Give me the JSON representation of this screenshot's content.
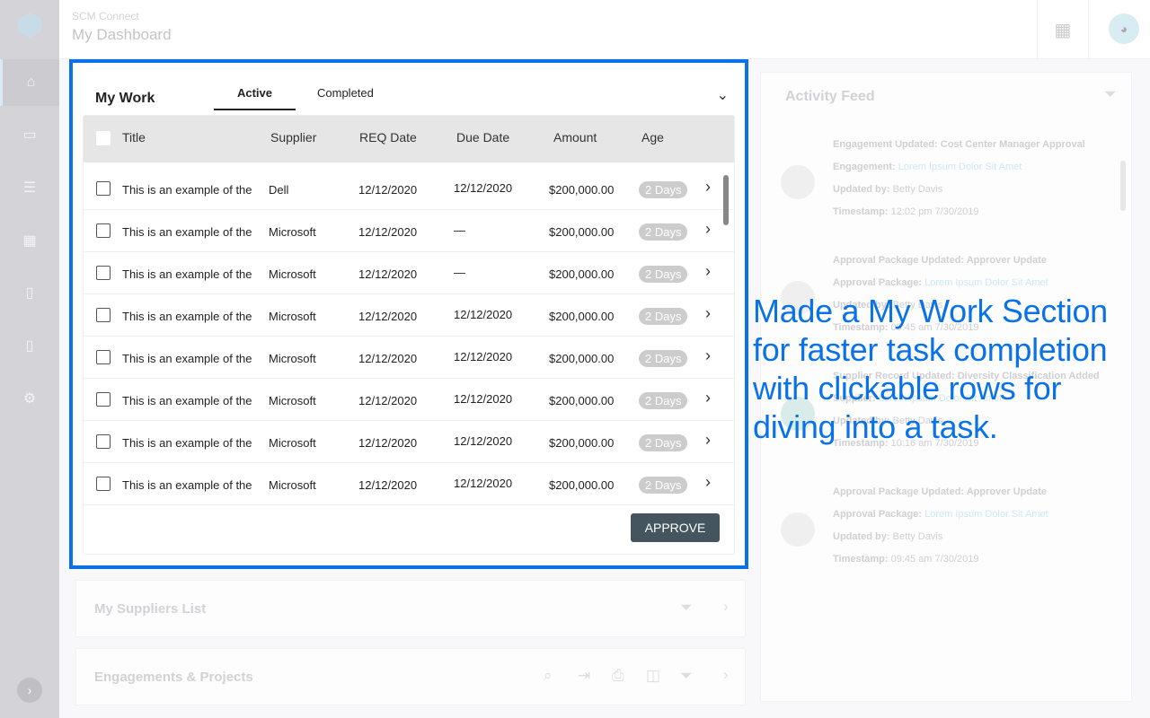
{
  "app": {
    "name": "SCM Connect",
    "page_title": "My Dashboard"
  },
  "sidebar": {
    "items": [
      "home-icon",
      "dashboard-icon",
      "tasks-icon",
      "table-icon",
      "contacts-icon",
      "reports-icon",
      "settings-icon"
    ]
  },
  "my_work": {
    "title": "My Work",
    "tabs": [
      "Active",
      "Completed"
    ],
    "columns": [
      "Title",
      "Supplier",
      "REQ Date",
      "Due Date",
      "Amount",
      "Age"
    ],
    "rows": [
      {
        "title": "This is an example of the",
        "supplier": "Dell",
        "req": "12/12/2020",
        "due": "12/12/2020",
        "amount": "$200,000.00",
        "age": "2 Days"
      },
      {
        "title": "This is an example of the",
        "supplier": "Microsoft",
        "req": "12/12/2020",
        "due": "—",
        "amount": "$200,000.00",
        "age": "2 Days"
      },
      {
        "title": "This is an example of the",
        "supplier": "Microsoft",
        "req": "12/12/2020",
        "due": "—",
        "amount": "$200,000.00",
        "age": "2 Days"
      },
      {
        "title": "This is an example of the",
        "supplier": "Microsoft",
        "req": "12/12/2020",
        "due": "12/12/2020",
        "amount": "$200,000.00",
        "age": "2 Days"
      },
      {
        "title": "This is an example of the",
        "supplier": "Microsoft",
        "req": "12/12/2020",
        "due": "12/12/2020",
        "amount": "$200,000.00",
        "age": "2 Days"
      },
      {
        "title": "This is an example of the",
        "supplier": "Microsoft",
        "req": "12/12/2020",
        "due": "12/12/2020",
        "amount": "$200,000.00",
        "age": "2 Days"
      },
      {
        "title": "This is an example of the",
        "supplier": "Microsoft",
        "req": "12/12/2020",
        "due": "12/12/2020",
        "amount": "$200,000.00",
        "age": "2 Days"
      },
      {
        "title": "This is an example of the",
        "supplier": "Microsoft",
        "req": "12/12/2020",
        "due": "12/12/2020",
        "amount": "$200,000.00",
        "age": "2 Days"
      }
    ],
    "approve_label": "APPROVE"
  },
  "suppliers": {
    "title": "My Suppliers List"
  },
  "engagements": {
    "title": "Engagements & Projects"
  },
  "feed": {
    "title": "Activity Feed",
    "items": [
      {
        "heading": "Engagement Updated: Cost Center Manager Approval",
        "label": "Engagement:",
        "link": "Lorem Ipsum Dolor Sit Amet",
        "by_label": "Updated by:",
        "by": "Betty Davis",
        "ts_label": "Timestamp:",
        "ts": "12:02 pm 7/30/2019"
      },
      {
        "heading": "Approval Package Updated: Approver Update",
        "label": "Approval Package:",
        "link": "Lorem Ipsum Dolor Sit Amet",
        "by_label": "Updated by:",
        "by": "Betty Davis",
        "ts_label": "Timestamp:",
        "ts": "09:45 am 7/30/2019"
      },
      {
        "heading": "Supplier Record Updated: Diversity Classification Added",
        "label": "Supplier:",
        "link": "Lorem Ipsum Dolor Sit Amet",
        "by_label": "Updated by:",
        "by": "Betty Davis",
        "ts_label": "Timestamp:",
        "ts": "10:16 am 7/30/2019"
      },
      {
        "heading": "Approval Package Updated: Approver Update",
        "label": "Approval Package:",
        "link": "Lorem Ipsum Dolor Sit Amet",
        "by_label": "Updated by:",
        "by": "Betty Davis",
        "ts_label": "Timestamp:",
        "ts": "09:45 am 7/30/2019"
      }
    ]
  },
  "annotation": "Made a My Work Section for faster task completion with clickable rows for diving into a task.",
  "colors": {
    "accent": "#0a72e8",
    "button": "#455560"
  }
}
